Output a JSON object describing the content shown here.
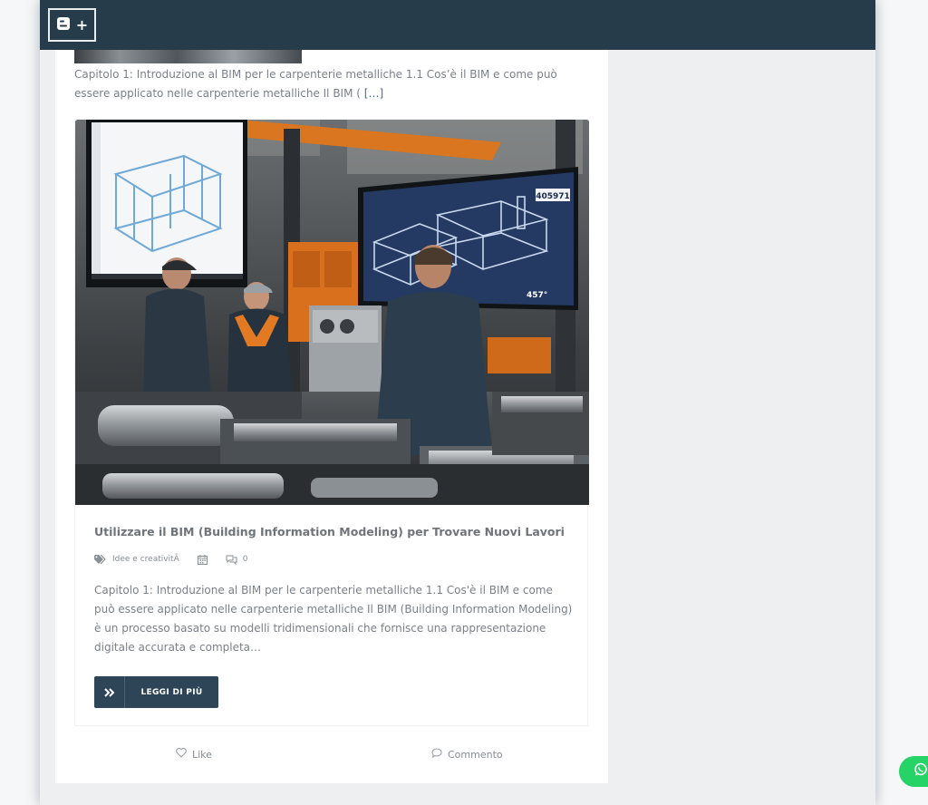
{
  "colors": {
    "topbar": "#263c4a",
    "accent_button": "#2d4556",
    "link": "#3f6f9a",
    "whatsapp": "#25d366"
  },
  "topbar": {
    "blogger_icon": "blogger-icon",
    "plus_label": "+"
  },
  "previous_post": {
    "excerpt": "Capitolo 1: Introduzione al BIM per le carpenterie metalliche 1.1 Cos’è il BIM e come può essere applicato nelle carpenterie metalliche Il BIM ( ",
    "more_link": "[…]"
  },
  "post": {
    "image_alt": "Tecnici in officina davanti a schermi con modelli BIM di strutture metalliche",
    "screen_readout": "405971",
    "screen_angle": "457°",
    "title": "Utilizzare il BIM (Building Information Modeling) per Trovare Nuovi Lavori",
    "category": "Idee e creativitÃ",
    "comments_count": "0",
    "excerpt": "Capitolo 1: Introduzione al BIM per le carpenterie metalliche 1.1 Cos'è il BIM e come può essere applicato nelle carpenterie metalliche Il BIM (Building Information Modeling) è un processo basato su modelli tridimensionali che fornisce una rappresentazione digitale accurata e completa…",
    "read_more_label": "LEGGI DI PIÙ"
  },
  "actions": {
    "like_label": "Like",
    "comment_label": "Commento"
  }
}
